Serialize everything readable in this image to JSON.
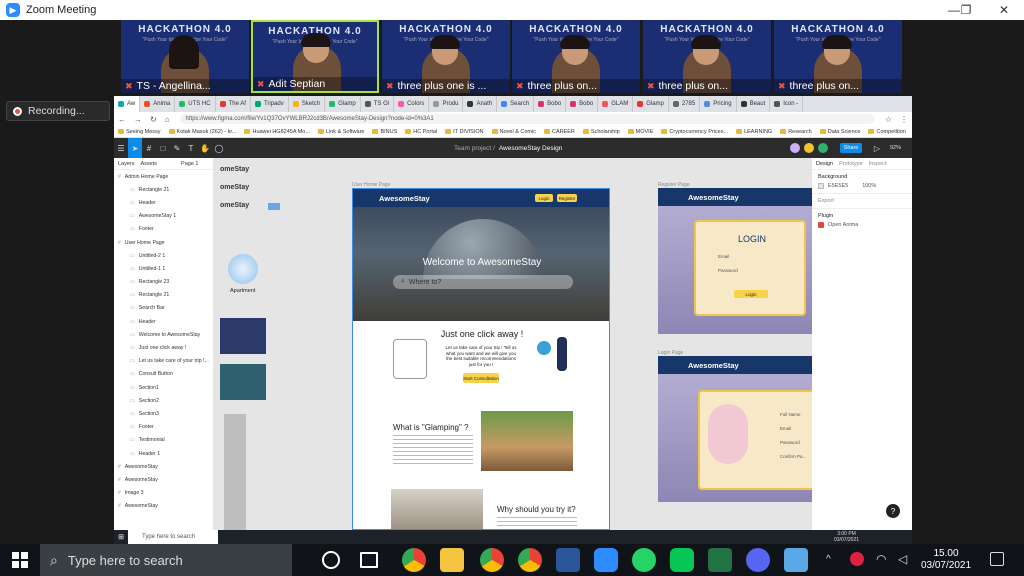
{
  "window": {
    "title": "Zoom Meeting"
  },
  "participants": [
    {
      "name": "TS - Angellina...",
      "active": false,
      "hair": "long"
    },
    {
      "name": "Adit Septian",
      "active": true,
      "hair": "short"
    },
    {
      "name": "three plus one is ...",
      "active": false,
      "hair": "short"
    },
    {
      "name": "three plus on...",
      "active": false,
      "hair": "short"
    },
    {
      "name": "three plus on...",
      "active": false,
      "hair": "short"
    },
    {
      "name": "three plus on...",
      "active": false,
      "hair": "short"
    }
  ],
  "thumb_banner": {
    "title": "HACKATHON 4.0",
    "subtitle": "\"Push Your Idea, Actualize Your Code\""
  },
  "recording": {
    "label": "Recording..."
  },
  "browser": {
    "tabs": [
      "Aw",
      "Anima",
      "UTS HC",
      "The Af",
      "Tripadv",
      "Sketch",
      "Glamp",
      "TS Gl",
      "Colors",
      "Produ",
      "Anath",
      "Search",
      "Bobo",
      "Bobo",
      "GLAM",
      "Glamp",
      "2785",
      "Pricing",
      "Beaut",
      "Icon -"
    ],
    "url": "https://www.figma.com/file/Yv1Q37OvYWLBRJ2cd3B/AwesomeStay-Design?node-id=0%3A1",
    "bookmarks": [
      "Seeing Messy",
      "Kotak Masuk (262) - kr...",
      "Huawei HG8245A Mo...",
      "Link & Software",
      "BINUS",
      "HC Portal",
      "IT DIVISION",
      "Novel & Comic",
      "CAREER",
      "Scholarship",
      "MOVIE",
      "Cryptocurrency Prices...",
      "LEARNING",
      "Research",
      "Data Science",
      "Competition",
      "Other Bookmarks"
    ]
  },
  "figma": {
    "project": "Team project /",
    "file": "AwesomeStay Design",
    "share": "Share",
    "zoom": "92%",
    "panel_tabs": [
      "Layers",
      "Assets",
      "Page 1"
    ],
    "layers": [
      {
        "t": "Admin Home Page",
        "d": 0
      },
      {
        "t": "Rectangle 21",
        "d": 1
      },
      {
        "t": "Header",
        "d": 1
      },
      {
        "t": "AwesomeStay 1",
        "d": 1
      },
      {
        "t": "Footer",
        "d": 1
      },
      {
        "t": "User Home Page",
        "d": 0
      },
      {
        "t": "Untitled-2 1",
        "d": 1
      },
      {
        "t": "Untitled-1 1",
        "d": 1
      },
      {
        "t": "Rectangle 23",
        "d": 1
      },
      {
        "t": "Rectangle 21",
        "d": 1
      },
      {
        "t": "Search Bar",
        "d": 1
      },
      {
        "t": "Header",
        "d": 1
      },
      {
        "t": "Welcome to AwesomeStay",
        "d": 1
      },
      {
        "t": "Just one click away !",
        "d": 1
      },
      {
        "t": "Let us take care of your trip !...",
        "d": 1
      },
      {
        "t": "Consult Button",
        "d": 1
      },
      {
        "t": "Section1",
        "d": 1
      },
      {
        "t": "Section2",
        "d": 1
      },
      {
        "t": "Section3",
        "d": 1
      },
      {
        "t": "Footer",
        "d": 1
      },
      {
        "t": "Testimonial",
        "d": 1
      },
      {
        "t": "Header 1",
        "d": 1
      },
      {
        "t": "AwesomeStay",
        "d": 0
      },
      {
        "t": "AwesomeStay",
        "d": 0
      },
      {
        "t": "Image 3",
        "d": 0
      },
      {
        "t": "AwesomeStay",
        "d": 0
      }
    ],
    "design_tabs": [
      "Design",
      "Prototype",
      "Inspect"
    ],
    "background_label": "Background",
    "background_hex": "E5E5E5",
    "background_opacity": "100%",
    "export_label": "Export",
    "plugin_label": "Plugin",
    "plugin_name": "Open Anima"
  },
  "canvas": {
    "left_labels": [
      "omeStay",
      "omeStay",
      "omeStay"
    ],
    "apartment_label": "Apartment",
    "user_frame_label": "User Home Page",
    "register_frame_label": "Register Page",
    "login_frame_label": "Login Page",
    "brand": "AwesomeStay",
    "login_btn": "Login",
    "register_btn": "Register",
    "hero_title": "Welcome to AwesomeStay",
    "search_placeholder": "Where to?",
    "section1_title": "Just one click away !",
    "section1_body": "Let us take care of your trip ! Tell us what you want and we will give you the best suitable recommendations just for you !",
    "consult_btn": "Start Consultation",
    "section2_title": "What is \"Glamping\" ?",
    "section3_title": "Why should you try it?",
    "login_title": "LOGIN",
    "email_label": "Email",
    "password_label": "Password",
    "login_action": "Login",
    "full_name_label": "Full Name",
    "email_label2": "Email",
    "password_label2": "Password",
    "confirm_label": "Confirm Pa..."
  },
  "taskbar": {
    "search": "Type here to search",
    "time": "15.00",
    "date": "03/07/2021"
  },
  "inner_taskbar": {
    "search": "Type here to search",
    "time": "3:00 PM",
    "date": "03/07/2021"
  }
}
